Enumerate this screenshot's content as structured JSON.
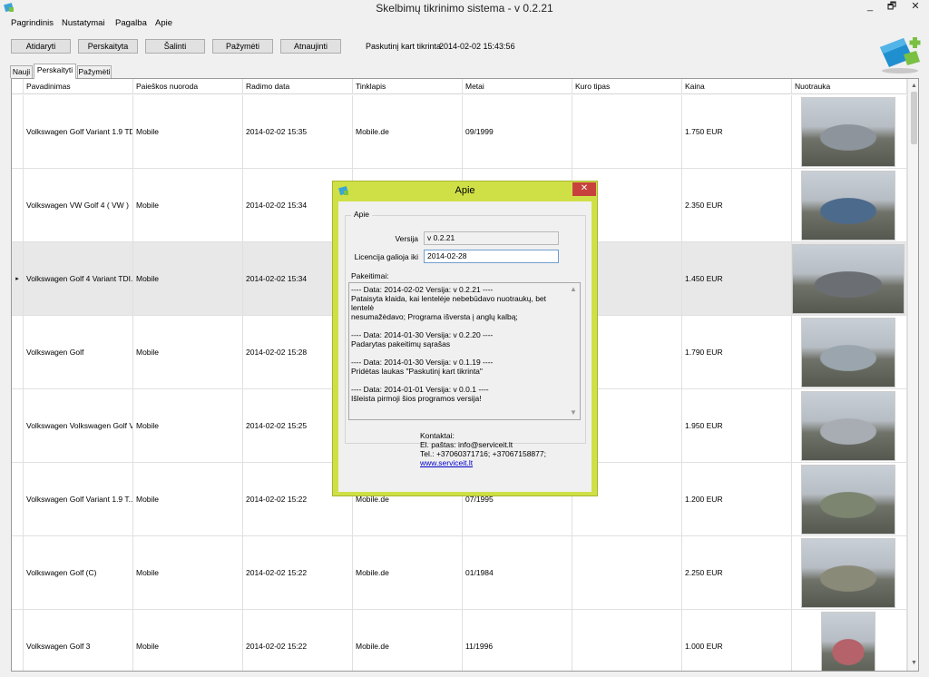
{
  "window": {
    "title": "Skelbimų tikrinimo sistema - v 0.2.21",
    "minimize": "_",
    "maximize": "🗗",
    "close": "✕"
  },
  "menu": [
    "Pagrindinis",
    "Nustatymai",
    "Pagalba",
    "Apie"
  ],
  "toolbar": {
    "buttons": [
      "Atidaryti",
      "Perskaityta",
      "Šalinti",
      "Pažymėti",
      "Atnaujinti"
    ],
    "last_check_label": "Paskutinį kart tikrinta",
    "last_check_value": "2014-02-02 15:43:56"
  },
  "tabs": [
    "Nauji",
    "Perskaityti",
    "Pažymėti"
  ],
  "active_tab": "Perskaityti",
  "grid": {
    "columns": [
      "Pavadinimas",
      "Paieškos nuoroda",
      "Radimo data",
      "Tinklapis",
      "Metai",
      "Kuro tipas",
      "Kaina",
      "Nuotrauka"
    ],
    "rows": [
      {
        "name": "Volkswagen Golf Variant 1.9 TDI",
        "search": "Mobile",
        "date": "2014-02-02 15:35",
        "site": "Mobile.de",
        "year": "09/1999",
        "fuel": "",
        "price": "1.750 EUR"
      },
      {
        "name": "Volkswagen VW Golf 4 ( VW )",
        "search": "Mobile",
        "date": "2014-02-02 15:34",
        "site": "Mobile.de",
        "year": "",
        "fuel": "",
        "price": "2.350 EUR"
      },
      {
        "name": "Volkswagen Golf 4 Variant TDI...",
        "search": "Mobile",
        "date": "2014-02-02 15:34",
        "site": "Mobile.de",
        "year": "",
        "fuel": "",
        "price": "1.450 EUR",
        "selected": true
      },
      {
        "name": "Volkswagen Golf",
        "search": "Mobile",
        "date": "2014-02-02 15:28",
        "site": "Mobile.de",
        "year": "",
        "fuel": "",
        "price": "1.790 EUR"
      },
      {
        "name": "Volkswagen Volkswagen Golf V...",
        "search": "Mobile",
        "date": "2014-02-02 15:25",
        "site": "Mobile.de",
        "year": "",
        "fuel": "",
        "price": "1.950 EUR"
      },
      {
        "name": "Volkswagen Golf Variant 1.9 T...",
        "search": "Mobile",
        "date": "2014-02-02 15:22",
        "site": "Mobile.de",
        "year": "07/1995",
        "fuel": "",
        "price": "1.200 EUR"
      },
      {
        "name": "Volkswagen Golf (C)",
        "search": "Mobile",
        "date": "2014-02-02 15:22",
        "site": "Mobile.de",
        "year": "01/1984",
        "fuel": "",
        "price": "2.250 EUR"
      },
      {
        "name": "Volkswagen Golf 3",
        "search": "Mobile",
        "date": "2014-02-02 15:22",
        "site": "Mobile.de",
        "year": "11/1996",
        "fuel": "",
        "price": "1.000 EUR"
      }
    ]
  },
  "dialog": {
    "title": "Apie",
    "close": "✕",
    "group_title": "Apie",
    "version_label": "Versija",
    "version_value": "v 0.2.21",
    "license_label": "Licencija galioja iki",
    "license_value": "2014-02-28",
    "changes_label": "Pakeitimai:",
    "changes": [
      "---- Data: 2014-02-02 Versija: v 0.2.21 ----",
      "Pataisyta klaida, kai lentelėje nebebūdavo nuotraukų, bet lentelė",
      "nesumažėdavo; Programa išversta į anglų kalbą;",
      "",
      "---- Data: 2014-01-30 Versija: v 0.2.20 ----",
      "Padarytas pakeitimų sąrašas",
      "",
      "---- Data: 2014-01-30 Versija: v 0.1.19 ----",
      "Pridėtas laukas \"Paskutinį kart tikrinta\"",
      "",
      "---- Data: 2014-01-01 Versija: v 0.0.1 ----",
      "Išleista pirmoji šios programos versija!"
    ],
    "contacts_title": "Kontaktai:",
    "email_line": "El. paštas: info@serviceit.lt",
    "phone_line": "Tel.: +37060371716; +37067158877;",
    "website": "www.serviceit.lt"
  },
  "colors": {
    "dialog_frame": "#cfe047",
    "close_button": "#c7423c",
    "link": "#0000cc"
  }
}
